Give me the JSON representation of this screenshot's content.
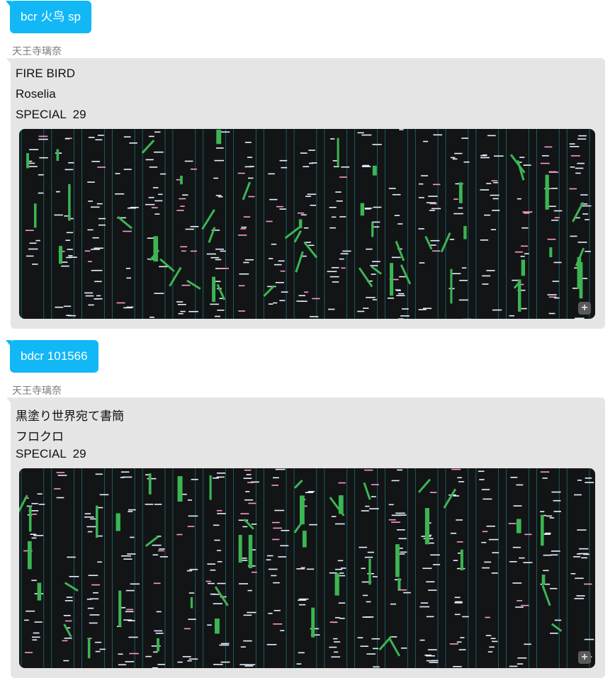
{
  "messages": [
    {
      "user_text": "bcr 火鸟 sp",
      "sender": "天王寺璃奈",
      "lines": [
        "FIRE BIRD",
        "Roselia",
        "SPECIAL  29"
      ],
      "image_icon": "zoom-plus-icon"
    },
    {
      "user_text": "bdcr 101566",
      "sender": "天王寺璃奈",
      "lines": [
        "黒塗り世界宛て書簡",
        "フロクロ",
        "SPECIAL  29"
      ],
      "image_icon": "zoom-plus-icon"
    }
  ],
  "colors": {
    "user_bubble": "#12b7f5",
    "bot_bubble": "#e5e5e5",
    "chart_bg": "#121416",
    "note_green": "#3cb553",
    "lane_line": "#1f8a8a"
  }
}
